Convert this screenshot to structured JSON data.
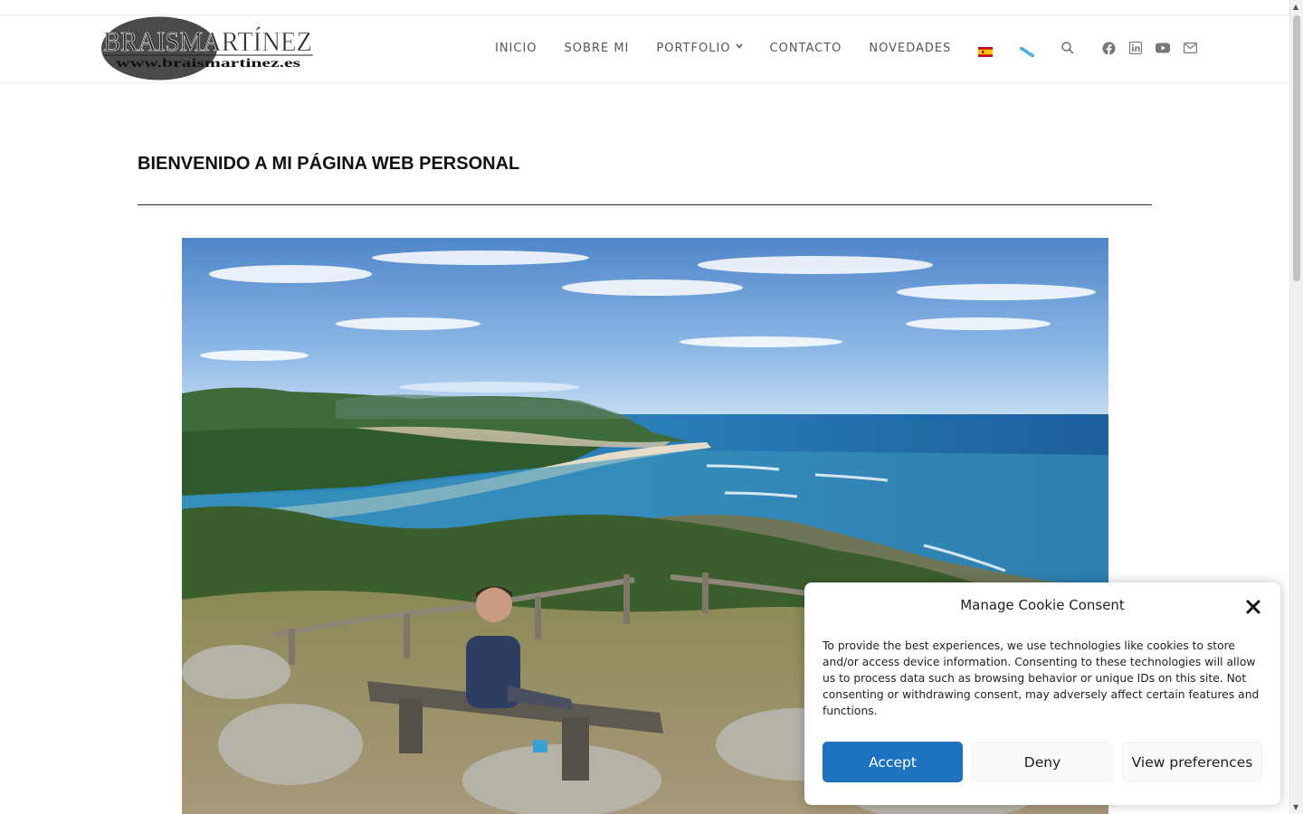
{
  "header": {
    "logo": {
      "name": "BRAISMARTÍNEZ",
      "url_text": "www.braismartinez.es"
    },
    "nav": [
      {
        "label": "INICIO"
      },
      {
        "label": "SOBRE MI"
      },
      {
        "label": "PORTFOLIO",
        "has_dropdown": true
      },
      {
        "label": "CONTACTO"
      },
      {
        "label": "NOVEDADES"
      }
    ],
    "languages": [
      "spain-flag-icon",
      "galicia-flag-icon"
    ],
    "search_icon": "search-icon",
    "social_icons": [
      "facebook-icon",
      "linkedin-icon",
      "youtube-icon",
      "mail-icon"
    ]
  },
  "main": {
    "title": "BIENVENIDO A MI PÁGINA WEB PERSONAL"
  },
  "cookie_banner": {
    "title": "Manage Cookie Consent",
    "text": "To provide the best experiences, we use technologies like cookies to store and/or access device information. Consenting to these technologies will allow us to process data such as browsing behavior or unique IDs on this site. Not consenting or withdrawing consent, may adversely affect certain features and functions.",
    "accept_label": "Accept",
    "deny_label": "Deny",
    "preferences_label": "View preferences"
  },
  "colors": {
    "accent": "#1e73be",
    "nav_text": "#555555",
    "title": "#111111"
  }
}
